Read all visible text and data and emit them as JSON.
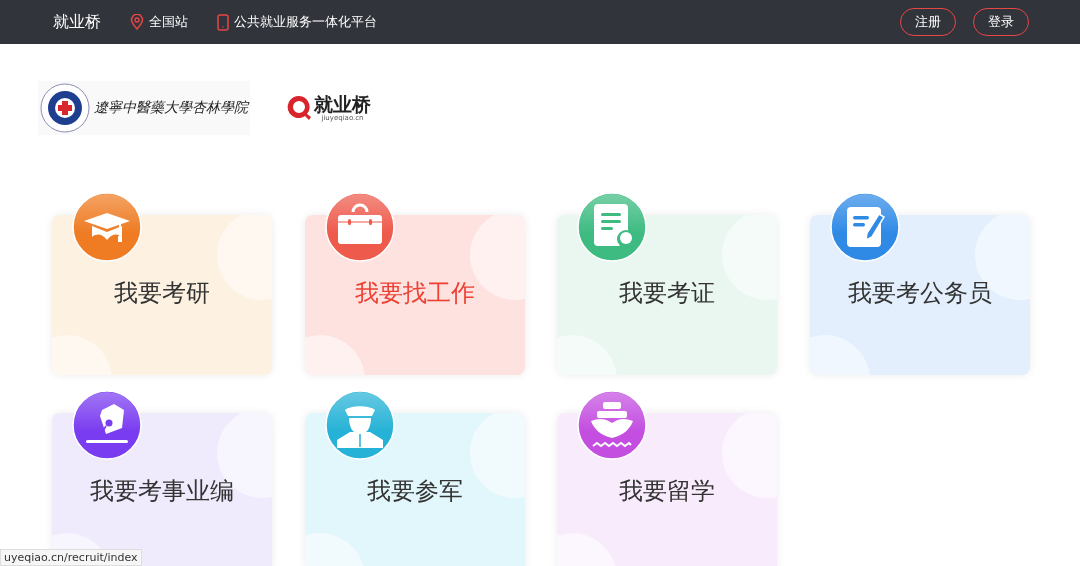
{
  "top_bar": {
    "brand": "就业桥",
    "location": "全国站",
    "platform": "公共就业服务一体化平台",
    "buttons": [
      "注册",
      "登录"
    ]
  },
  "logos": {
    "school_name": "遼寧中醫藥大學杏林學院",
    "brand_name": "就业桥",
    "brand_domain": "jiuyeqiao.cn"
  },
  "cards": [
    {
      "title": "我要考研",
      "kind": "graduation",
      "color": "#ef7b22",
      "selected": false
    },
    {
      "title": "我要找工作",
      "kind": "briefcase",
      "color": "#ee5a4c",
      "selected": true
    },
    {
      "title": "我要考证",
      "kind": "certificate",
      "color": "#3dbb80",
      "selected": false
    },
    {
      "title": "我要考公务员",
      "kind": "document",
      "color": "#2f8ae6",
      "selected": false
    },
    {
      "title": "我要考事业编",
      "kind": "pen",
      "color": "#7a3cf0",
      "selected": false
    },
    {
      "title": "我要参军",
      "kind": "soldier",
      "color": "#25b2d6",
      "selected": false
    },
    {
      "title": "我要留学",
      "kind": "ship",
      "color": "#c34ee0",
      "selected": false
    }
  ],
  "status_bar": {
    "url": "uyeqiao.cn/recruit/index"
  }
}
